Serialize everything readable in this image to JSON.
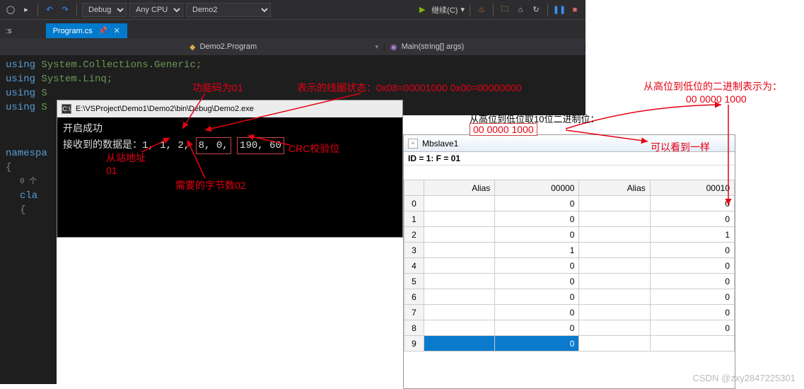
{
  "toolbar": {
    "config": "Debug",
    "platform": "Any CPU",
    "project": "Demo2",
    "run_label": "继续(C)"
  },
  "tabs": {
    "left": ":s",
    "active": "Program.cs"
  },
  "nav": {
    "left": "Demo2.Program",
    "right": "Main(string[] args)"
  },
  "code": {
    "l1a": "using",
    "l1b": " System.Collections.Generic;",
    "l2a": "using",
    "l2b": " System.Linq;",
    "l3a": "using",
    "l3b": " S",
    "l4a": "using",
    "l4b": " S",
    "l5": "namespa",
    "brace1": "{",
    "refs": "0 个",
    "cla": "cla",
    "brace2": "{"
  },
  "console": {
    "path": "E:\\VSProject\\Demo1\\Demo2\\bin\\Debug\\Demo2.exe",
    "line1": "开启成功",
    "line2a": "接收到的数据是：1, 1, 2,",
    "line2b": "8, 0,",
    "line2c": "190, 60"
  },
  "ann": {
    "func_code": "功能码为01",
    "coil_state": "表示的线圈状态：0x08=00001000   0x00=00000000",
    "take10": "从高位到低位取10位二进制位：",
    "bits": "00 0000 1000",
    "binrep": "从高位到低位的二进制表示为：",
    "bits2": "00 0000 1000",
    "same": "可以看到一样",
    "slave_addr1": "从站地址",
    "slave_addr2": "01",
    "bytes": "需要的字节数02",
    "crc": "CRC校验位"
  },
  "mbslave": {
    "title": "Mbslave1",
    "id_line": "ID = 1: F = 01",
    "headers": [
      "Alias",
      "00000",
      "Alias",
      "00010"
    ],
    "rows": [
      {
        "n": "0",
        "a1": "",
        "v1": "0",
        "a2": "",
        "v2": "0"
      },
      {
        "n": "1",
        "a1": "",
        "v1": "0",
        "a2": "",
        "v2": "0"
      },
      {
        "n": "2",
        "a1": "",
        "v1": "0",
        "a2": "",
        "v2": "1"
      },
      {
        "n": "3",
        "a1": "",
        "v1": "1",
        "a2": "",
        "v2": "0"
      },
      {
        "n": "4",
        "a1": "",
        "v1": "0",
        "a2": "",
        "v2": "0"
      },
      {
        "n": "5",
        "a1": "",
        "v1": "0",
        "a2": "",
        "v2": "0"
      },
      {
        "n": "6",
        "a1": "",
        "v1": "0",
        "a2": "",
        "v2": "0"
      },
      {
        "n": "7",
        "a1": "",
        "v1": "0",
        "a2": "",
        "v2": "0"
      },
      {
        "n": "8",
        "a1": "",
        "v1": "0",
        "a2": "",
        "v2": "0"
      },
      {
        "n": "9",
        "a1": "",
        "v1": "0",
        "a2": "",
        "v2": "",
        "sel": true
      }
    ]
  },
  "watermark": "CSDN @zxy2847225301"
}
